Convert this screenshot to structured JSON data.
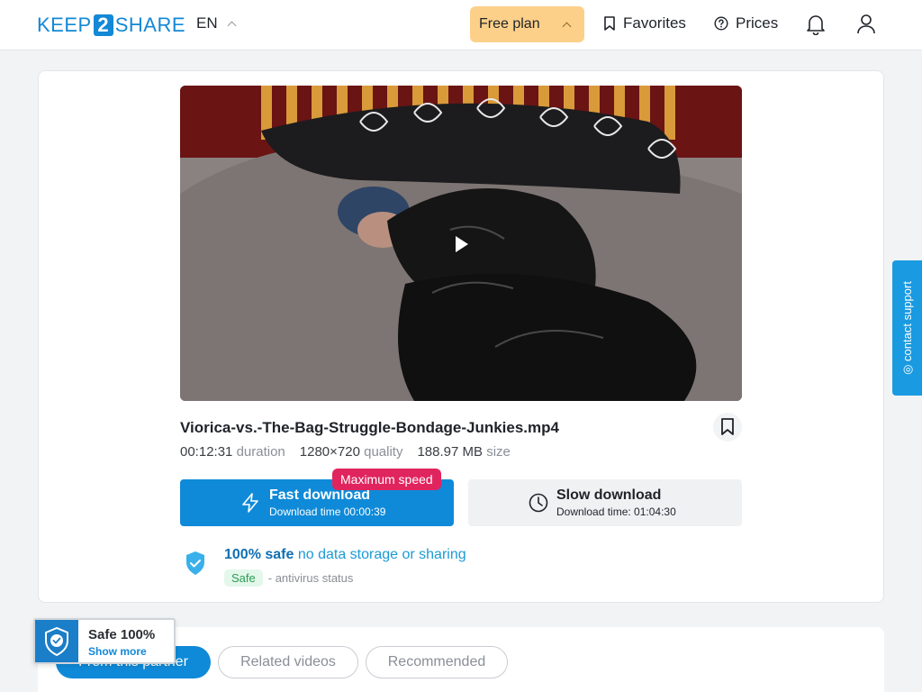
{
  "header": {
    "logo_left": "KEEP",
    "logo_mid": "2",
    "logo_right": "SHARE",
    "language": "EN",
    "plan_label": "Free plan",
    "favorites_label": "Favorites",
    "prices_label": "Prices"
  },
  "file": {
    "name": "Viorica-vs.-The-Bag-Struggle-Bondage-Junkies.mp4",
    "duration_value": "00:12:31",
    "duration_label": "duration",
    "quality_value": "1280×720",
    "quality_label": "quality",
    "size_value": "188.97 MB",
    "size_label": "size"
  },
  "download": {
    "fast_title": "Fast download",
    "fast_sub": "Download time 00:00:39",
    "max_badge": "Maximum speed",
    "slow_title": "Slow download",
    "slow_sub": "Download time: 01:04:30"
  },
  "safety": {
    "strong": "100% safe",
    "light": "no data storage or sharing",
    "chip": "Safe",
    "status": "- antivirus status"
  },
  "support_label": "contact support",
  "tabs": [
    {
      "label": "From this partner"
    },
    {
      "label": "Related videos"
    },
    {
      "label": "Recommended"
    }
  ],
  "safe_badge": {
    "title": "Safe 100%",
    "link": "Show more"
  },
  "colors": {
    "accent": "#0f8ad8",
    "plan": "#fdd08a",
    "badge": "#e0245e"
  }
}
